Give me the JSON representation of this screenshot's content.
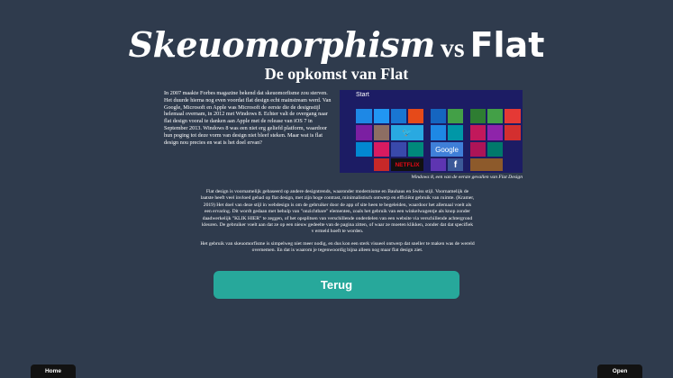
{
  "header": {
    "title_part1": "Skeuomorphism",
    "title_vs": "vs",
    "title_part2": "Flat",
    "subtitle": "De opkomst van Flat"
  },
  "intro_text": "In 2007 maakte Forbes magazine bekend dat skeuomorfisme zou sterven. Het duurde hierna nog even voordat flat design echt mainstream werd. Van Google, Microsoft en Apple was Microsoft de eerste die de designstijl helemaal overnam, in 2012 met Windows 8. Echter valt de overgang naar flat design vooral te danken aan Apple met de release van iOS 7 in September 2013. Windows 8 was een niet erg geliefd platform, waardoor hun poging tot deze vorm van design niet bleef steken. Maar wat is flat design nou precies en wat is het doel ervan?",
  "figure": {
    "start_label": "Start",
    "tile_labels": {
      "twitter": "🐦",
      "google": "Google",
      "netflix": "NETFLIX",
      "facebook": "f"
    },
    "caption": "Windows 8, een van de eerste gevallen van Flat Design"
  },
  "body": {
    "paragraph1": "Flat design is voornamelijk gebaseerd op andere designtrends, waaronder modernisme en Bauhaus en Swiss stijl. Voornamelijk de laatste heeft veel invloed gehad op flat design, met zijn hoge contrast, minimalistisch ontwerp en efficiënt gebruik van ruimte. (Kramer, 2019) Het doel van deze stijl in webdesign is om de gebruiker door de app of site heen te begeleiden, waardoor het allemaal voelt als een ervaring. Dit wordt gedaan met behulp van \"onzichtbare\" elementen, zoals het gebruik van een winkelwagentje als knop zonder daadwerkelijk \"KLIK HIER\" te zeggen, of het opsplitsen van verschillende onderdelen van een website via verschillende achtergrond kleuren. De gebruiker voelt aan dat ze op een nieuw gedeelte van de pagina zitten, of waar ze moeten klikken, zonder dat dat specifiek v ermeld hoeft te worden.",
    "paragraph2": "Het gebruik van skeuomorfisme is simpelweg niet meer nodig, en dus kon een sterk visueel ontwerp dat sneller te maken was de wereld overnemen. En dat is waarom je tegenwoordig bijna alleen nog maar flat design ziet."
  },
  "buttons": {
    "back_label": "Terug",
    "home_label": "Home",
    "open_label": "Open"
  },
  "colors": {
    "background": "#2f3b4d",
    "accent_button": "#27a89b",
    "tab_background": "#121212",
    "windows_background": "#1c1c64"
  }
}
